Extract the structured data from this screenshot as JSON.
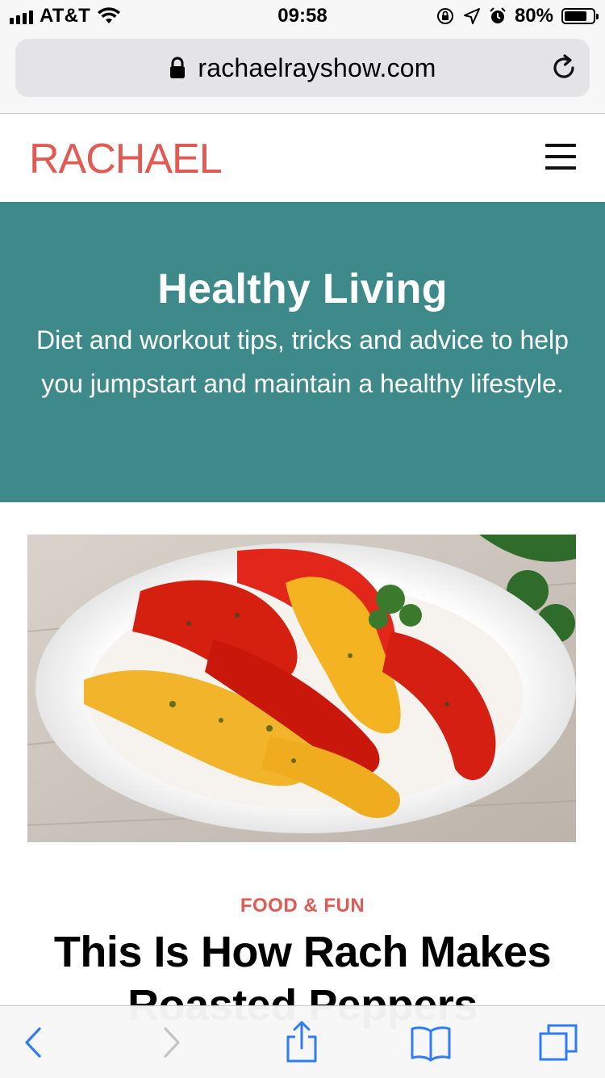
{
  "status_bar": {
    "carrier": "AT&T",
    "time": "09:58",
    "battery_percent": "80%",
    "battery_level": 0.8
  },
  "browser": {
    "url": "rachaelrayshow.com",
    "icons": [
      "lock-icon",
      "reload-icon"
    ]
  },
  "site": {
    "logo": "RACHAEL",
    "brand_color": "#e35a52",
    "menu_icon": "hamburger-menu-icon"
  },
  "hero": {
    "title": "Healthy Living",
    "description": "Diet and workout tips, tricks and advice to help you jumpstart and maintain a healthy lifestyle.",
    "background_color": "#3e8a8b"
  },
  "article": {
    "image": "roasted-peppers-photo",
    "category": "FOOD & FUN",
    "title": "This Is How Rach Makes Roasted Peppers"
  },
  "toolbar": {
    "buttons": [
      "back-icon",
      "forward-icon",
      "share-icon",
      "bookmarks-icon",
      "tabs-icon"
    ],
    "accent_color": "#2f7cf6"
  }
}
